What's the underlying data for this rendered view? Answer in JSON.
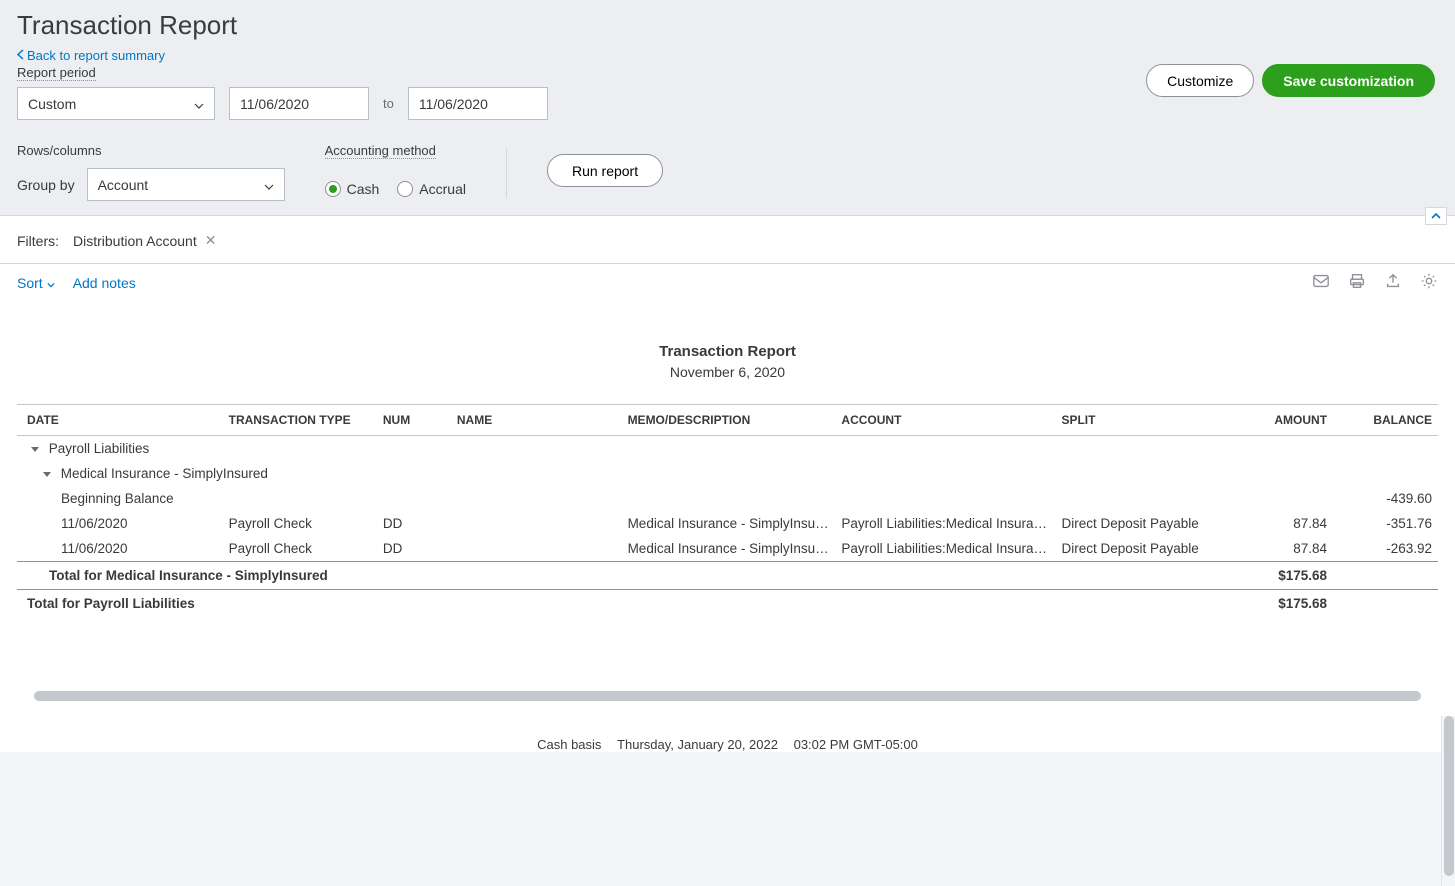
{
  "header": {
    "title": "Transaction Report",
    "back_link": "Back to report summary",
    "report_period_label": "Report period",
    "customize_label": "Customize",
    "save_label": "Save customization"
  },
  "period": {
    "preset": "Custom",
    "from": "11/06/2020",
    "to_label": "to",
    "to": "11/06/2020"
  },
  "rows_cols": {
    "section_label": "Rows/columns",
    "group_by_label": "Group by",
    "group_by_value": "Account"
  },
  "accounting_method": {
    "section_label": "Accounting method",
    "cash_label": "Cash",
    "accrual_label": "Accrual",
    "selected": "cash"
  },
  "run_report_label": "Run report",
  "filters": {
    "label": "Filters:",
    "chip": "Distribution Account"
  },
  "toolbar": {
    "sort_label": "Sort",
    "add_notes_label": "Add notes"
  },
  "report": {
    "title": "Transaction Report",
    "date": "November 6, 2020",
    "columns": {
      "date": "DATE",
      "ttype": "TRANSACTION TYPE",
      "num": "NUM",
      "name": "NAME",
      "memo": "MEMO/DESCRIPTION",
      "account": "ACCOUNT",
      "split": "SPLIT",
      "amount": "AMOUNT",
      "balance": "BALANCE"
    },
    "group1": "Payroll Liabilities",
    "group2": "Medical Insurance - SimplyInsured",
    "begin_balance_label": "Beginning Balance",
    "begin_balance_value": "-439.60",
    "rows": [
      {
        "date": "11/06/2020",
        "ttype": "Payroll Check",
        "num": "DD",
        "name": "",
        "memo": "Medical Insurance - SimplyInsured",
        "account": "Payroll Liabilities:Medical Insura…",
        "split": "Direct Deposit Payable",
        "amount": "87.84",
        "balance": "-351.76"
      },
      {
        "date": "11/06/2020",
        "ttype": "Payroll Check",
        "num": "DD",
        "name": "",
        "memo": "Medical Insurance - SimplyInsur…",
        "account": "Payroll Liabilities:Medical Insura…",
        "split": "Direct Deposit Payable",
        "amount": "87.84",
        "balance": "-263.92"
      }
    ],
    "total_group2_label": "Total for Medical Insurance - SimplyInsured",
    "total_group2_amount": "$175.68",
    "total_group1_label": "Total for Payroll Liabilities",
    "total_group1_amount": "$175.68"
  },
  "footer": {
    "basis": "Cash basis",
    "date": "Thursday, January 20, 2022",
    "time": "03:02 PM GMT-05:00"
  }
}
